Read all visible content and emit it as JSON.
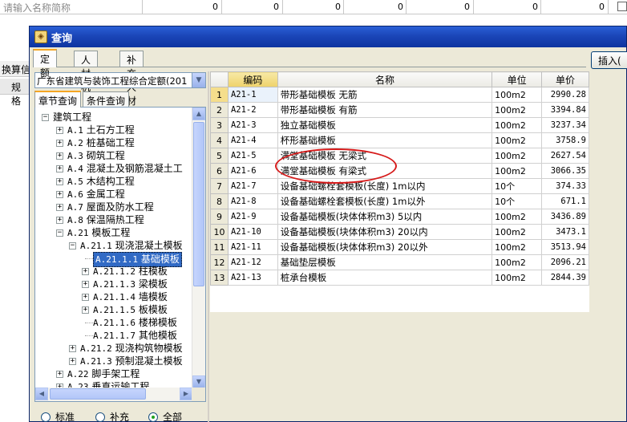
{
  "background": {
    "search_placeholder": "请输入名称简称",
    "zeros": [
      "0",
      "0",
      "0",
      "0",
      "0",
      "0",
      "0"
    ],
    "left_label_1": "换算信",
    "left_label_2": "规格"
  },
  "dialog": {
    "title": "查询",
    "tabs": [
      "定额",
      "人材机",
      "补充人材机"
    ],
    "insert_button": "插入(",
    "quota_library": "广东省建筑与装饰工程综合定额(201",
    "subtabs": [
      "章节查询",
      "条件查询"
    ],
    "radios": [
      {
        "label": "标准",
        "checked": false
      },
      {
        "label": "补充",
        "checked": false
      },
      {
        "label": "全部",
        "checked": true
      }
    ]
  },
  "tree": [
    {
      "level": 0,
      "expander": "−",
      "label": "建筑工程"
    },
    {
      "level": 1,
      "expander": "+",
      "code": "A.1",
      "label": "土石方工程"
    },
    {
      "level": 1,
      "expander": "+",
      "code": "A.2",
      "label": "桩基础工程"
    },
    {
      "level": 1,
      "expander": "+",
      "code": "A.3",
      "label": "砌筑工程"
    },
    {
      "level": 1,
      "expander": "+",
      "code": "A.4",
      "label": "混凝土及钢筋混凝土工"
    },
    {
      "level": 1,
      "expander": "+",
      "code": "A.5",
      "label": "木结构工程"
    },
    {
      "level": 1,
      "expander": "+",
      "code": "A.6",
      "label": "金属工程"
    },
    {
      "level": 1,
      "expander": "+",
      "code": "A.7",
      "label": "屋面及防水工程"
    },
    {
      "level": 1,
      "expander": "+",
      "code": "A.8",
      "label": "保温隔热工程"
    },
    {
      "level": 1,
      "expander": "−",
      "code": "A.21",
      "label": "模板工程"
    },
    {
      "level": 2,
      "expander": "−",
      "code": "A.21.1",
      "label": "现浇混凝土模板"
    },
    {
      "level": 3,
      "expander": "",
      "code": "A.21.1.1",
      "label": "基础模板",
      "selected": true
    },
    {
      "level": 3,
      "expander": "+",
      "code": "A.21.1.2",
      "label": "柱模板"
    },
    {
      "level": 3,
      "expander": "+",
      "code": "A.21.1.3",
      "label": "梁模板"
    },
    {
      "level": 3,
      "expander": "+",
      "code": "A.21.1.4",
      "label": "墙模板"
    },
    {
      "level": 3,
      "expander": "+",
      "code": "A.21.1.5",
      "label": "板模板"
    },
    {
      "level": 3,
      "expander": "",
      "code": "A.21.1.6",
      "label": "楼梯模板"
    },
    {
      "level": 3,
      "expander": "",
      "code": "A.21.1.7",
      "label": "其他模板"
    },
    {
      "level": 2,
      "expander": "+",
      "code": "A.21.2",
      "label": "现浇构筑物模板"
    },
    {
      "level": 2,
      "expander": "+",
      "code": "A.21.3",
      "label": "预制混凝土模板"
    },
    {
      "level": 1,
      "expander": "+",
      "code": "A.22",
      "label": "脚手架工程"
    },
    {
      "level": 1,
      "expander": "+",
      "code": "A.23",
      "label": "垂直运输工程"
    }
  ],
  "grid": {
    "headers": [
      "",
      "编码",
      "名称",
      "单位",
      "单价"
    ],
    "rows": [
      {
        "n": "1",
        "code": "A21-1",
        "name": "带形基础模板 无筋",
        "unit": "100m2",
        "price": "2990.28"
      },
      {
        "n": "2",
        "code": "A21-2",
        "name": "带形基础模板 有筋",
        "unit": "100m2",
        "price": "3394.84"
      },
      {
        "n": "3",
        "code": "A21-3",
        "name": "独立基础模板",
        "unit": "100m2",
        "price": "3237.34"
      },
      {
        "n": "4",
        "code": "A21-4",
        "name": "杯形基础模板",
        "unit": "100m2",
        "price": "3758.9"
      },
      {
        "n": "5",
        "code": "A21-5",
        "name": "满堂基础模板 无梁式",
        "unit": "100m2",
        "price": "2627.54"
      },
      {
        "n": "6",
        "code": "A21-6",
        "name": "满堂基础模板 有梁式",
        "unit": "100m2",
        "price": "3066.35"
      },
      {
        "n": "7",
        "code": "A21-7",
        "name": "设备基础螺栓套模板(长度) 1m以内",
        "unit": "10个",
        "price": "374.33"
      },
      {
        "n": "8",
        "code": "A21-8",
        "name": "设备基础螺栓套模板(长度) 1m以外",
        "unit": "10个",
        "price": "671.1"
      },
      {
        "n": "9",
        "code": "A21-9",
        "name": "设备基础模板(块体体积m3) 5以内",
        "unit": "100m2",
        "price": "3436.89"
      },
      {
        "n": "10",
        "code": "A21-10",
        "name": "设备基础模板(块体体积m3) 20以内",
        "unit": "100m2",
        "price": "3473.1"
      },
      {
        "n": "11",
        "code": "A21-11",
        "name": "设备基础模板(块体体积m3) 20以外",
        "unit": "100m2",
        "price": "3513.94"
      },
      {
        "n": "12",
        "code": "A21-12",
        "name": "基础垫层模板",
        "unit": "100m2",
        "price": "2096.21"
      },
      {
        "n": "13",
        "code": "A21-13",
        "name": "桩承台模板",
        "unit": "100m2",
        "price": "2844.39"
      }
    ]
  }
}
